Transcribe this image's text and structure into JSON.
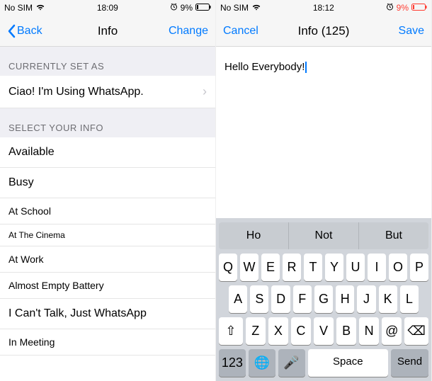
{
  "left": {
    "status": {
      "carrier": "No SIM",
      "time": "18:09",
      "battery": "9%"
    },
    "nav": {
      "back": "Back",
      "title": "Info",
      "action": "Change"
    },
    "section1": "CURRENTLY SET AS",
    "current": "Ciao! I'm Using WhatsApp.",
    "section2": "SELECT YOUR INFO",
    "options": [
      "Available",
      "Busy",
      "At School",
      "At The Cinema",
      "At Work",
      "Almost Empty Battery",
      "I Can't Talk, Just WhatsApp",
      "In Meeting"
    ]
  },
  "right": {
    "status": {
      "carrier": "No SIM",
      "time": "18:12",
      "battery": "9%"
    },
    "nav": {
      "cancel": "Cancel",
      "title": "Info (125)",
      "save": "Save"
    },
    "text": "Hello Everybody!",
    "suggestions": [
      "Ho",
      "Not",
      "But"
    ],
    "keys_row1": [
      "Q",
      "W",
      "E",
      "R",
      "T",
      "Y",
      "U",
      "I",
      "O",
      "P"
    ],
    "keys_row2": [
      "A",
      "S",
      "D",
      "F",
      "G",
      "H",
      "J",
      "K",
      "L"
    ],
    "keys_row3": [
      "Z",
      "X",
      "C",
      "V",
      "B",
      "N",
      "@"
    ],
    "shift": "⇧",
    "backspace": "⌫",
    "numkey": "123",
    "globe": "🌐",
    "mic": "🎤",
    "space": "Space",
    "send": "Send"
  }
}
